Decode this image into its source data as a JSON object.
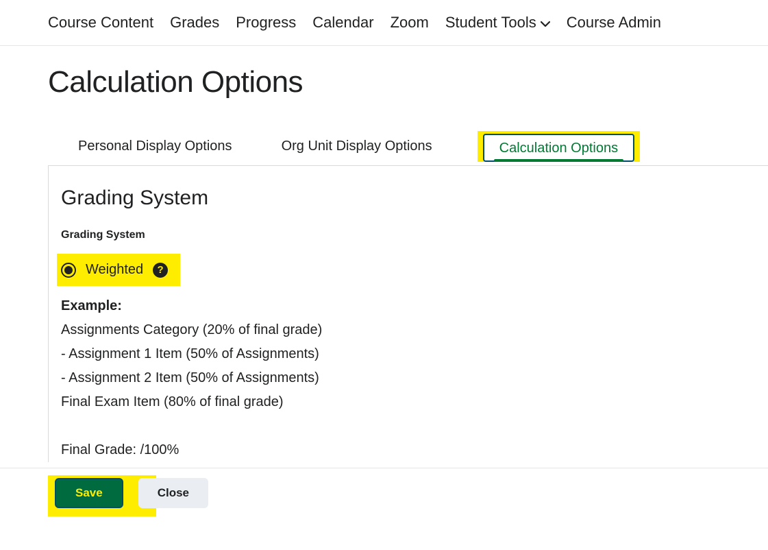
{
  "nav": {
    "items": [
      "Course Content",
      "Grades",
      "Progress",
      "Calendar",
      "Zoom",
      "Student Tools",
      "Course Admin"
    ]
  },
  "page": {
    "title": "Calculation Options"
  },
  "tabs": {
    "personal": "Personal Display Options",
    "org": "Org Unit Display Options",
    "calc": "Calculation Options"
  },
  "grading": {
    "section_heading": "Grading System",
    "field_label": "Grading System",
    "option_weighted": "Weighted",
    "example_label": "Example:",
    "lines": [
      "Assignments Category (20% of final grade)",
      " - Assignment 1 Item (50% of Assignments)",
      " - Assignment 2 Item (50% of Assignments)",
      "Final Exam Item (80% of final grade)"
    ],
    "final_line": "Final Grade: /100%"
  },
  "buttons": {
    "save": "Save",
    "close": "Close"
  }
}
